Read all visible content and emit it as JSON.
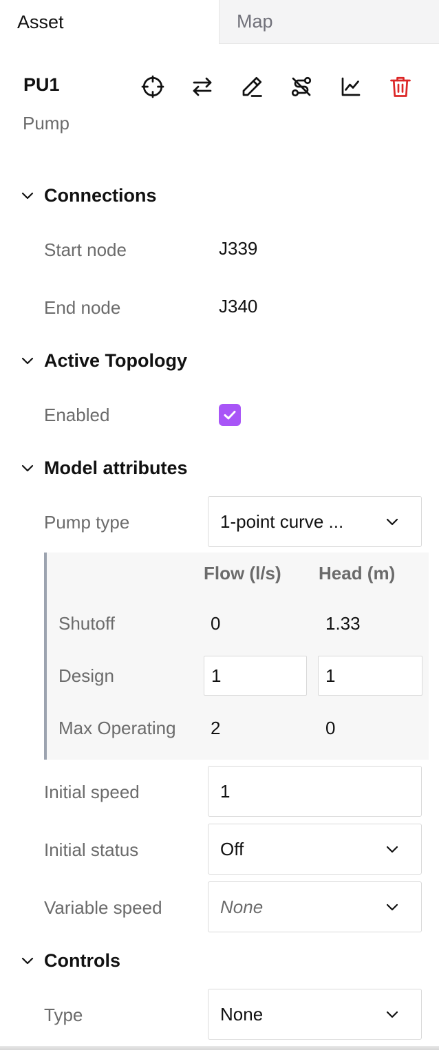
{
  "tabs": {
    "asset": "Asset",
    "map": "Map"
  },
  "asset": {
    "id": "PU1",
    "type": "Pump"
  },
  "toolbar": {
    "icons": [
      "crosshair-icon",
      "swap-icon",
      "pencil-icon",
      "route-off-icon",
      "chart-icon",
      "trash-icon"
    ],
    "delete_color": "#dc2626"
  },
  "connections": {
    "title": "Connections",
    "start_node_label": "Start node",
    "start_node_value": "J339",
    "end_node_label": "End node",
    "end_node_value": "J340"
  },
  "active_topology": {
    "title": "Active Topology",
    "enabled_label": "Enabled",
    "enabled": true,
    "checkbox_color": "#a855f7"
  },
  "model_attributes": {
    "title": "Model attributes",
    "pump_type_label": "Pump type",
    "pump_type_value": "1-point curve ...",
    "curve": {
      "flow_header": "Flow (l/s)",
      "head_header": "Head (m)",
      "rows": [
        {
          "label": "Shutoff",
          "flow": "0",
          "head": "1.33"
        },
        {
          "label": "Design",
          "flow": "1",
          "head": "1"
        },
        {
          "label": "Max Operating",
          "flow": "2",
          "head": "0"
        }
      ]
    },
    "initial_speed_label": "Initial speed",
    "initial_speed_value": "1",
    "initial_status_label": "Initial status",
    "initial_status_value": "Off",
    "variable_speed_label": "Variable speed",
    "variable_speed_placeholder": "None"
  },
  "controls": {
    "title": "Controls",
    "type_label": "Type",
    "type_value": "None"
  }
}
